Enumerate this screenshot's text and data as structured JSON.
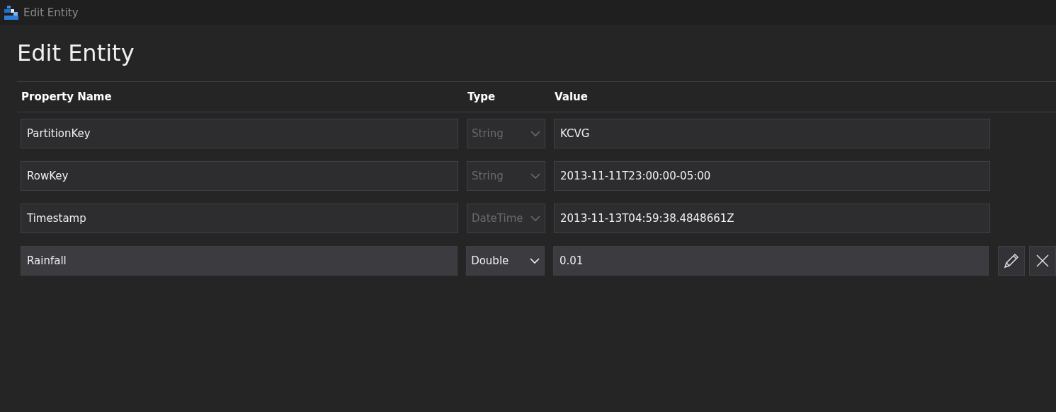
{
  "window": {
    "title": "Edit Entity"
  },
  "heading": "Edit Entity",
  "columns": [
    "Property Name",
    "Type",
    "Value"
  ],
  "rows": [
    {
      "name": "PartitionKey",
      "type": "String",
      "value": "KCVG",
      "editable": false
    },
    {
      "name": "RowKey",
      "type": "String",
      "value": "2013-11-11T23:00:00-05:00",
      "editable": false
    },
    {
      "name": "Timestamp",
      "type": "DateTime",
      "value": "2013-11-13T04:59:38.4848661Z",
      "editable": false
    },
    {
      "name": "Rainfall",
      "type": "Double",
      "value": "0.01",
      "editable": true
    }
  ]
}
